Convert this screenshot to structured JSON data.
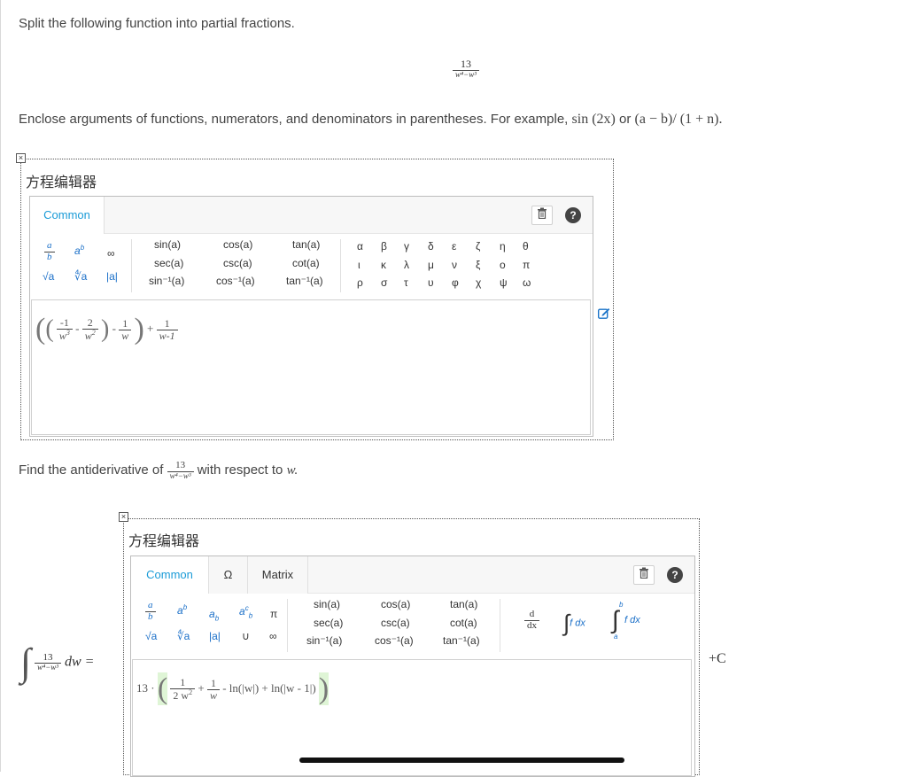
{
  "question1": {
    "prompt": "Split the following function into partial fractions.",
    "function": {
      "numerator": "13",
      "denominator": "w⁴−w³"
    },
    "instructions_pre": "Enclose arguments of functions, numerators, and denominators in parentheses. For example,",
    "example1": "sin (2x)",
    "or_text": "or",
    "example2": "(a − b)/ (1 + n).",
    "end_text": ""
  },
  "editor1": {
    "label": "方程编辑器",
    "tabs": [
      "Common"
    ],
    "answer_parts": {
      "t1_num": "-1",
      "t1_den": "w",
      "t1_den_exp": "3",
      "minus1": "-",
      "t2_num": "2",
      "t2_den": "w",
      "t2_den_exp": "2",
      "minus2": "-",
      "t3_num": "1",
      "t3_den": "w",
      "plus": "+",
      "t4_num": "1",
      "t4_den": "w-1"
    }
  },
  "palette_common": {
    "frac_a": "a",
    "frac_b": "b",
    "power_base": "a",
    "power_exp": "b",
    "infinity": "∞",
    "sqrt": "√a",
    "nthroot": "∜a",
    "abs": "|a|",
    "trig": [
      [
        "sin(a)",
        "cos(a)",
        "tan(a)"
      ],
      [
        "sec(a)",
        "csc(a)",
        "cot(a)"
      ],
      [
        "sin⁻¹(a)",
        "cos⁻¹(a)",
        "tan⁻¹(a)"
      ]
    ],
    "greek": [
      [
        "α",
        "β",
        "γ",
        "δ",
        "ε",
        "ζ",
        "η",
        "θ"
      ],
      [
        "ι",
        "κ",
        "λ",
        "μ",
        "ν",
        "ξ",
        "ο",
        "π"
      ],
      [
        "ρ",
        "σ",
        "τ",
        "υ",
        "φ",
        "χ",
        "ψ",
        "ω"
      ]
    ]
  },
  "question2": {
    "prompt_pre": "Find the antiderivative of",
    "prompt_post": "with respect to",
    "variable": "w.",
    "function": {
      "numerator": "13",
      "denominator": "w⁴−w³"
    },
    "integral_lhs": "dw =",
    "plus_c": "+C"
  },
  "editor2": {
    "label": "方程编辑器",
    "tabs": [
      "Common",
      "Ω",
      "Matrix"
    ],
    "palette_extra": {
      "a_sub": "a",
      "sub_b": "b",
      "a_sup_sub": "a",
      "pi": "π",
      "union": "∪",
      "infinity": "∞",
      "deriv_num": "d",
      "deriv_den": "dx",
      "int_text": "f dx",
      "defint_upper": "b",
      "defint_lower": "a"
    },
    "answer_parts": {
      "coef": "13 ·",
      "f1_num": "1",
      "f1_den": "2 w",
      "f1_exp": "2",
      "plus1": "+",
      "f2_num": "1",
      "f2_den": "w",
      "rest": "- ln(|w|) + ln(|w - 1|)"
    }
  }
}
